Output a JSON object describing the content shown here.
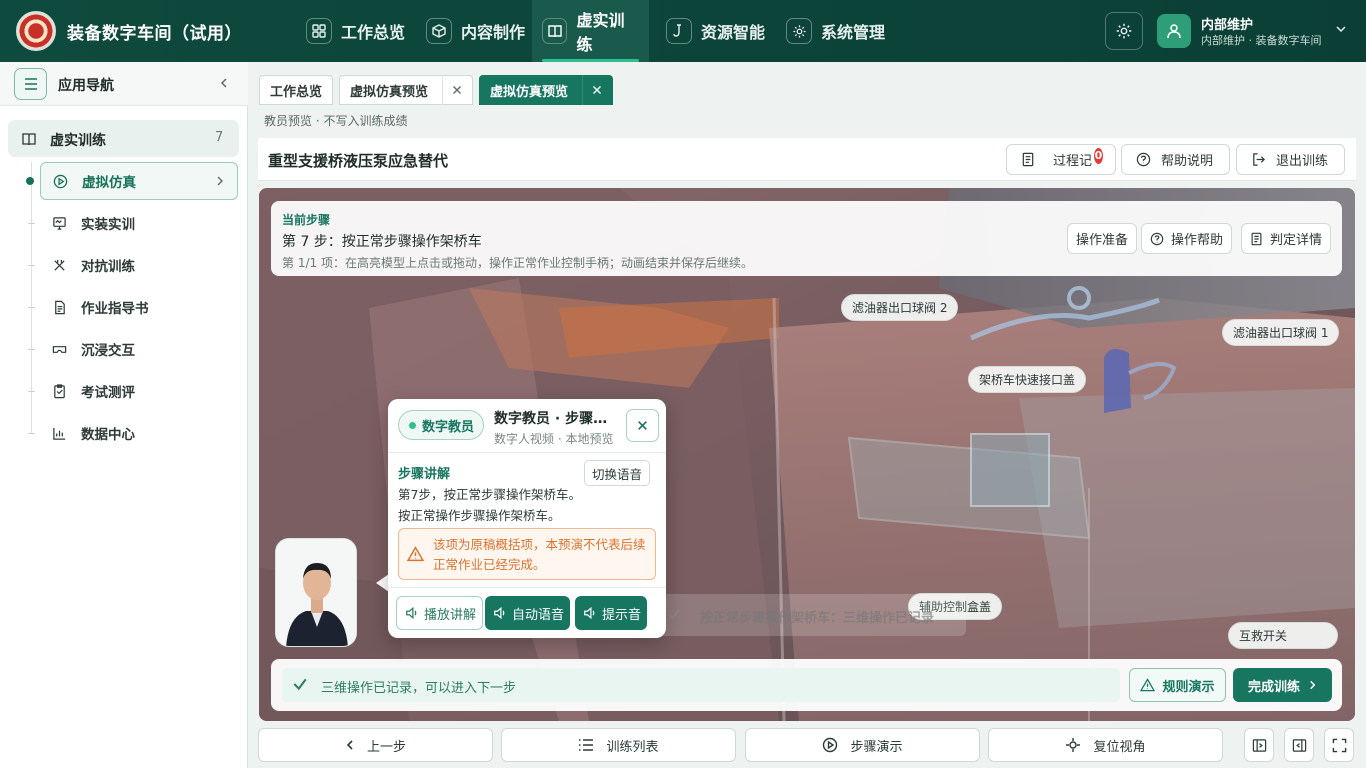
{
  "app": {
    "title": "装备数字车间（试用）"
  },
  "nav": [
    {
      "label": "工作总览",
      "icon": "grid-icon"
    },
    {
      "label": "内容制作",
      "icon": "cube-icon"
    },
    {
      "label": "虚实训练",
      "icon": "book-icon",
      "active": true
    },
    {
      "label": "资源智能",
      "icon": "hook-icon"
    },
    {
      "label": "系统管理",
      "icon": "gear-icon"
    }
  ],
  "user": {
    "name": "内部维护",
    "sub": "内部维护 · 装备数字车间"
  },
  "sidebar": {
    "title": "应用导航",
    "group": {
      "label": "虚实训练",
      "count": "7"
    },
    "items": [
      {
        "label": "虚拟仿真",
        "icon": "play-circle-icon",
        "active": true
      },
      {
        "label": "实装实训",
        "icon": "monitor-icon"
      },
      {
        "label": "对抗训练",
        "icon": "swords-icon"
      },
      {
        "label": "作业指导书",
        "icon": "document-icon"
      },
      {
        "label": "沉浸交互",
        "icon": "vr-headset-icon"
      },
      {
        "label": "考试测评",
        "icon": "exam-icon"
      },
      {
        "label": "数据中心",
        "icon": "chart-icon"
      }
    ]
  },
  "tabs": [
    {
      "label": "工作总览",
      "closable": false
    },
    {
      "label": "虚拟仿真预览",
      "closable": true
    },
    {
      "label": "虚拟仿真预览",
      "closable": true,
      "active": true
    }
  ],
  "preview_note": "教员预览 · 不写入训练成绩",
  "header": {
    "title": "重型支援桥液压泵应急替代",
    "process_label": "过程记",
    "process_badge": "0",
    "help_label": "帮助说明",
    "exit_label": "退出训练"
  },
  "step": {
    "tag": "当前步骤",
    "title": "第 7 步：按正常步骤操作架桥车",
    "sub": "第 1/1 项：在高亮模型上点击或拖动，操作正常作业控制手柄；动画结束并保存后继续。",
    "btn_prepare": "操作准备",
    "btn_help": "操作帮助",
    "btn_detail": "判定详情"
  },
  "scene_labels": {
    "filter_valve_2": "滤油器出口球阀 2",
    "filter_valve_1": "滤油器出口球阀 1",
    "quick_cover": "架桥车快速接口盖",
    "aux_box_cover": "辅助控制盒盖",
    "rescue_switch": "互救开关",
    "ghost_status": "按正常步骤操作架桥车：三维操作已记录"
  },
  "popup": {
    "chip": "数字教员",
    "title": "数字教员 · 步骤讲解",
    "sub": "数字人视频 · 本地预览",
    "section": "步骤讲解",
    "switch_voice": "切换语音",
    "body": "第7步，按正常步骤操作架桥车。按正常操作步骤操作架桥车。",
    "warning": "该项为原稿概括项，本预演不代表后续正常作业已经完成。",
    "btn_play": "播放讲解",
    "btn_auto": "自动语音",
    "btn_tone": "提示音"
  },
  "status": {
    "text": "三维操作已记录，可以进入下一步",
    "rule_btn": "规则演示",
    "finish_btn": "完成训练"
  },
  "bottom": {
    "prev": "上一步",
    "list": "训练列表",
    "demo": "步骤演示",
    "reset": "复位视角"
  },
  "colors": {
    "brand": "#0e4a3d",
    "accent": "#177660",
    "warning": "#d9732e",
    "badge": "#e53935"
  }
}
